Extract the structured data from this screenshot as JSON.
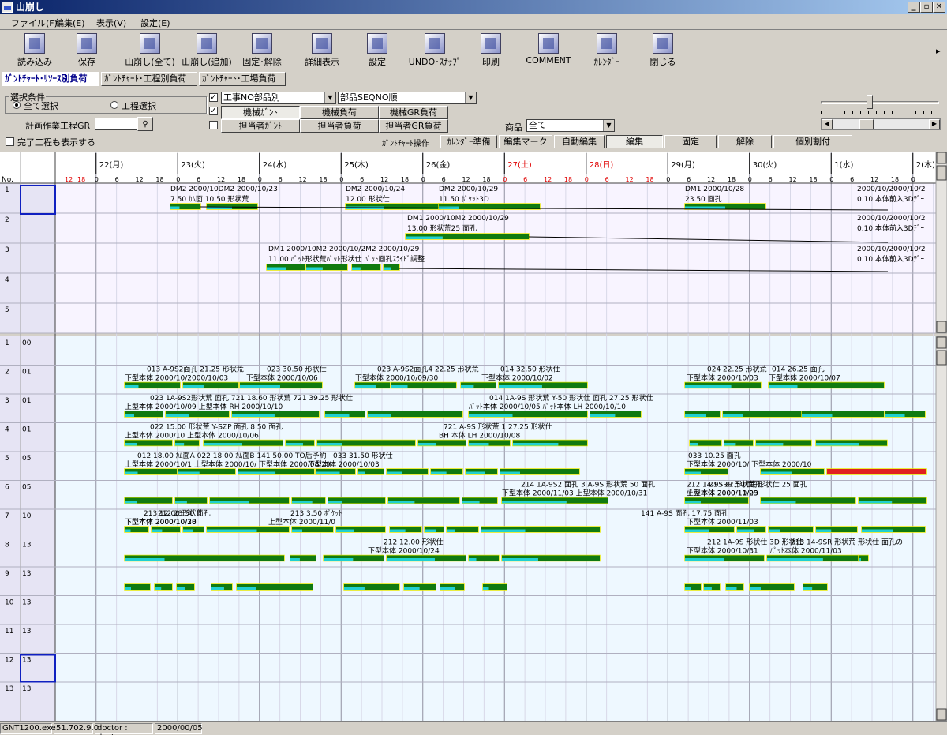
{
  "window": {
    "title": "山崩し"
  },
  "menu": [
    "ファイル(F)",
    "編集(E)",
    "表示(V)",
    "設定(E)"
  ],
  "toolbar": [
    {
      "label": "読み込み",
      "icon": "open-folder-icon"
    },
    {
      "label": "保存",
      "icon": "save-icon"
    },
    {
      "label": "山崩し(全て)",
      "icon": "level-all-icon"
    },
    {
      "label": "山崩し(追加)",
      "icon": "level-add-icon"
    },
    {
      "label": "固定･解除",
      "icon": "lock-toggle-icon"
    },
    {
      "label": "詳細表示",
      "icon": "magnifier-icon"
    },
    {
      "label": "設定",
      "icon": "settings-icon"
    },
    {
      "label": "UNDO･ｽﾅｯﾌﾟ",
      "icon": "undo-icon"
    },
    {
      "label": "印刷",
      "icon": "printer-icon"
    },
    {
      "label": "COMMENT",
      "icon": "comment-icon"
    },
    {
      "label": "ｶﾚﾝﾀﾞｰ",
      "icon": "calendar-icon"
    },
    {
      "label": "閉じる",
      "icon": "exit-door-icon"
    }
  ],
  "tabs": [
    "ｶﾞﾝﾄﾁｬｰﾄ･ﾘｿｰｽ別負荷",
    "ｶﾞﾝﾄﾁｬｰﾄ･工程別負荷",
    "ｶﾞﾝﾄﾁｬｰﾄ･工場負荷"
  ],
  "filter": {
    "group_label": "選択条件",
    "radio_all": "全て選択",
    "radio_process": "工程選択",
    "plan_gr_label": "計画作業工程GR",
    "show_done_label": "完了工程も表示する",
    "sort1": "工事NO部品別",
    "sort2": "部品SEQNO順",
    "btn_machine_gantt": "機械ｶﾞﾝﾄ",
    "btn_machine_load": "機械負荷",
    "btn_machine_gr_load": "機械GR負荷",
    "btn_person_gantt": "担当者ｶﾞﾝﾄ",
    "btn_person_load": "担当者負荷",
    "btn_person_gr_load": "担当者GR負荷",
    "product_label": "商品",
    "product_value": "全て"
  },
  "gantt_ops": {
    "label": "ｶﾞﾝﾄﾁｬｰﾄ操作",
    "buttons": [
      "ｶﾚﾝﾀﾞｰ準備",
      "編集マーク",
      "自動編集",
      "編集",
      "固定",
      "解除",
      "個別割付"
    ]
  },
  "timeline": {
    "no_label": "No.",
    "days": [
      {
        "label": "22(月)",
        "holiday": false
      },
      {
        "label": "23(火)",
        "holiday": false
      },
      {
        "label": "24(水)",
        "holiday": false
      },
      {
        "label": "25(木)",
        "holiday": false
      },
      {
        "label": "26(金)",
        "holiday": false
      },
      {
        "label": "27(土)",
        "holiday": true
      },
      {
        "label": "28(日)",
        "holiday": true
      },
      {
        "label": "29(月)",
        "holiday": false
      },
      {
        "label": "30(火)",
        "holiday": false
      },
      {
        "label": "1(水)",
        "holiday": false
      },
      {
        "label": "2(木)",
        "holiday": false
      }
    ],
    "hours": [
      "0",
      "6",
      "12",
      "18"
    ],
    "pre_hours": [
      "12",
      "18"
    ]
  },
  "top_rows": [
    {
      "no": "1",
      "code": ""
    },
    {
      "no": "2",
      "code": ""
    },
    {
      "no": "3",
      "code": ""
    },
    {
      "no": "4",
      "code": ""
    },
    {
      "no": "5",
      "code": ""
    }
  ],
  "top_texts": [
    "DM2 2000/10DM2 2000/10/23",
    "7.50 ｶﾑ面  10.50 形状荒",
    "DM2 2000/10/24",
    "12.00 形状仕",
    "DM2 2000/10/29",
    "11.50 ﾎﾟｹｯﾄ3D",
    "DM1 2000/10/28",
    "23.50 面孔",
    "2000/10/2000/10/2",
    "0.10 本体前入3Dﾃﾞｰ",
    "DM1 2000/10M2 2000/10/29",
    "13.00 形状荒25 面孔",
    "2000/10/2000/10/2",
    "0.10 本体前入3Dﾃﾞｰ",
    "DM1 2000/10M2 2000/10/2M2 2000/10/29",
    "11.00 ﾊﾟｯﾄ形状荒ﾊﾟｯﾄ形状仕 ﾊﾟｯﾄ面孔ｽﾗｲﾄﾞ調整",
    "2000/10/2000/10/2",
    "0.10 本体前入3Dﾃﾞｰ"
  ],
  "bottom_rows": [
    {
      "no": "1",
      "code": "00"
    },
    {
      "no": "2",
      "code": "01"
    },
    {
      "no": "3",
      "code": "01"
    },
    {
      "no": "4",
      "code": "01"
    },
    {
      "no": "5",
      "code": "05"
    },
    {
      "no": "6",
      "code": "05"
    },
    {
      "no": "7",
      "code": "10"
    },
    {
      "no": "8",
      "code": "13"
    },
    {
      "no": "9",
      "code": "13"
    },
    {
      "no": "10",
      "code": "13"
    },
    {
      "no": "11",
      "code": "13"
    },
    {
      "no": "12",
      "code": "13"
    },
    {
      "no": "13",
      "code": "13"
    }
  ],
  "bottom_texts": [
    "013 A-9S2面孔 21.25 形状荒",
    "下型本体 2000/10/2000/10/03",
    "023 30.50 形状仕",
    "下型本体 2000/10/06",
    "023 A-9S2面孔4 22.25 形状荒",
    "下型本体 2000/10/09/30",
    "014 32.50 形状仕",
    "下型本体 2000/10/02",
    "024 22.25 形状荒",
    "下型本体 2000/10/03",
    "014 26.25 面孔",
    "下型本体 2000/10/07",
    "023 1A-9S2形状荒 面孔 721 18.60 形状荒 721 39.25 形状仕",
    "上型本体 2000/10/09 上型本体 RH 2000/10/10",
    "014 1A-9S 形状荒 Y-50 形状仕 面孔 27.25 形状仕",
    "ﾊﾟｯﾄ本体 2000/10/05 ﾊﾟｯﾄ本体 LH 2000/10/10",
    "022 15.00 形状荒 Y-SZP 面孔 8.50 面孔",
    "上型本体 2000/10 上型本体 2000/10/06",
    "721 A-9S 形状荒 1 27.25 形状仕",
    "BH 本体 LH 2000/10/08",
    "012 18.00 ｶﾑ面A  022 18.00 ｶﾑ面B  141 50.00 TO后予約",
    "上型本体 2000/10/1 上型本体 2000/10/ 下型本体 2000/08/29",
    "033 31.50 形状仕",
    "下型本体 2000/10/03",
    "033 10.25 面孔",
    "下型本体 2000/10/ 下型本体 2000/10",
    "214 1A-9S2 面孔 3 A-9S 形状荒 50 面孔",
    "下型本体 2000/11/03 上型本体 2000/10/31",
    "213 22.50 面孔",
    "上型本体 2000/11/03",
    "212 14-9SRP 形状荒 形状仕 25 面孔",
    "ﾊﾟｯﾄ本体 2000/10/29",
    "212 23.50 面孔",
    "下型本体 2000/10/28",
    "213 12.00 形状仕",
    "下型本体 2000/10/30",
    "213 3.50 ﾎﾟｹｯﾄ",
    "上型本体 2000/11/0",
    "141 A-9S 面孔 17.75 面孔",
    "下型本体 2000/11/03",
    "212 12.00 形状仕",
    "下型本体 2000/10/24",
    "212 1A-9S 形状仕 3D 形状仕",
    "下型本体 2000/10/31",
    "213 14-9SR 形状荒 形状仕 面孔の",
    "ﾊﾟｯﾄ本体 2000/11/03"
  ],
  "status": {
    "exe": "GNT1200.exe",
    "version": "51.702.9.0",
    "user": "doctor : doctor",
    "date": "2000/00/05"
  },
  "colors": {
    "bar_green": "#107a10",
    "bar_cyan": "#20d0d0",
    "bar_outline": "#e8e800",
    "bar_red": "#e02020",
    "holiday_text": "#e00000",
    "top_bg": "#f8f4ff",
    "bottom_bg": "#eef8ff"
  }
}
